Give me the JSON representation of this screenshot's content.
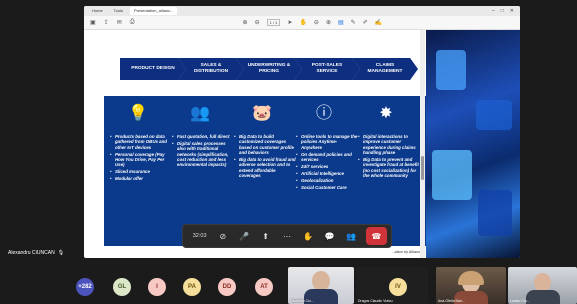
{
  "browser": {
    "tabs": [
      "Home",
      "Tools",
      "Presentation_allianz..."
    ],
    "window_controls": [
      "–",
      "□",
      "✕"
    ],
    "page_indicator": "1 / 1"
  },
  "slide": {
    "chevrons": [
      "PRODUCT DESIGN",
      "SALES & DISTRIBUTION",
      "UNDERWRITING & PRICING",
      "POST-SALES SERVICE",
      "CLAIMS MANAGEMENT"
    ],
    "columns": [
      {
        "icon": "💡",
        "icon_name": "lightbulb-icon",
        "items": [
          "Products based on data gathered from OBUs and other IoT devices",
          "Personal coverage (Pay How You Drive, Pay Per Use)",
          "Sliced Insurance",
          "Modular offer"
        ]
      },
      {
        "icon": "👥",
        "icon_name": "people-network-icon",
        "items": [
          "Fast quotation, full direct",
          "Digital sales processes also with traditional networks (simplification, cost reduction and less environmental impacts)"
        ]
      },
      {
        "icon": "🐷",
        "icon_name": "piggy-bank-icon",
        "items": [
          "Big Data to build customized coverages based on customer profile and behaviors",
          "Big data to avoid fraud and adverse selection and to extend affordable coverages"
        ]
      },
      {
        "icon": "ⓘ",
        "icon_name": "info-icon",
        "items": [
          "Online tools to manage the policies Anytime-Anywhere",
          "On demand policies and services",
          "24/7 services",
          "Artificial Intelligence",
          "Geolocalization",
          "Social Customer Care"
        ]
      },
      {
        "icon": "✸",
        "icon_name": "claims-burst-icon",
        "items": [
          "Digital interactions to improve customer experience during claims handling phase",
          "Big Data to prevent and investigate fraud at benefit (no cost socialization) for the whole community"
        ]
      }
    ],
    "footer": "...ation by Allianz"
  },
  "presenter": {
    "name": "Alexandru CIUNCAN",
    "mic_icon": "🎙"
  },
  "controls": {
    "timer": "32:03"
  },
  "participants": {
    "avatars": [
      {
        "label": "+282",
        "bg": "#4b53bc",
        "fg": "#ffffff"
      },
      {
        "label": "GL",
        "bg": "#dbe7c7",
        "fg": "#4a5a2a"
      },
      {
        "label": "I",
        "bg": "#f7c9c4",
        "fg": "#8a2b20"
      },
      {
        "label": "PA",
        "bg": "#f6df9b",
        "fg": "#6b5310"
      },
      {
        "label": "DD",
        "bg": "#f7c9c4",
        "fg": "#8a2b20"
      },
      {
        "label": "AT",
        "bg": "#f7c9c4",
        "fg": "#8a2b20"
      },
      {
        "label": "IV",
        "bg": "#f6df9b",
        "fg": "#6b5310"
      }
    ],
    "tiles": [
      {
        "label": "Laurentiu Ciu..."
      },
      {
        "label": "Dragos Claudiu Vlaicu"
      },
      {
        "label": "Ana-Ofelia Bad..."
      },
      {
        "label": "Lucian Ciu..."
      }
    ]
  }
}
